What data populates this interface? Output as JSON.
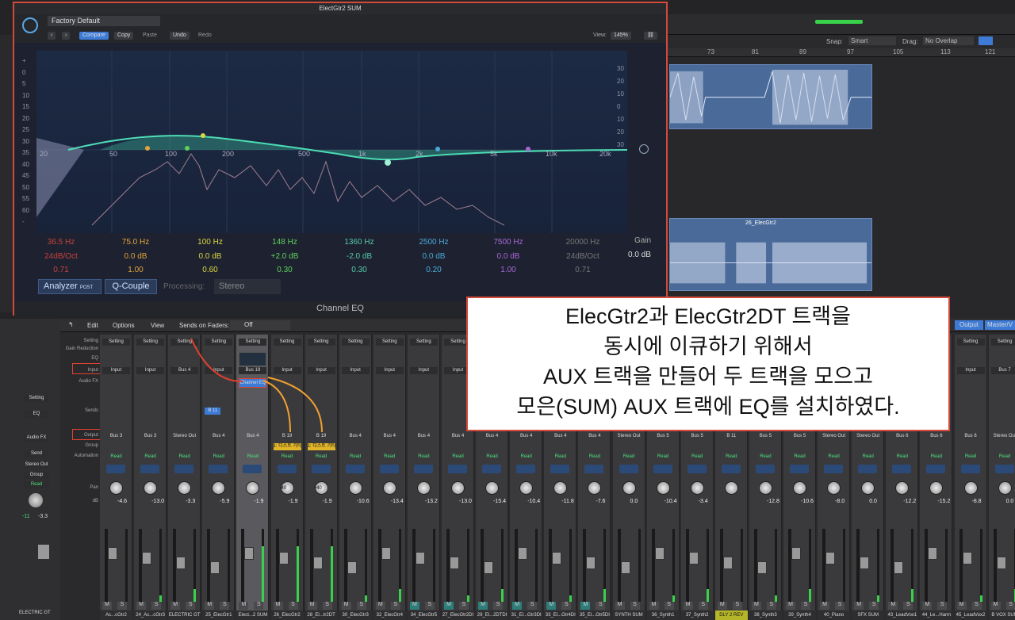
{
  "plugin": {
    "window_title": "ElectGtr2 SUM",
    "preset": "Factory Default",
    "buttons": {
      "compare": "Compare",
      "copy": "Copy",
      "paste": "Paste",
      "undo": "Undo",
      "redo": "Redo"
    },
    "view_label": "View:",
    "view_value": "145%",
    "freq_labels": [
      "20",
      "50",
      "100",
      "200",
      "500",
      "1k",
      "2k",
      "5k",
      "10k",
      "20k"
    ],
    "db_left": [
      "+",
      "0",
      "5",
      "10",
      "15",
      "20",
      "25",
      "30",
      "35",
      "40",
      "45",
      "50",
      "55",
      "60",
      "-"
    ],
    "db_right": [
      "30",
      "20",
      "10",
      "0",
      "10",
      "20",
      "30"
    ],
    "bands": [
      {
        "freq": "36.5 Hz",
        "gain": "24dB/Oct",
        "q": "0.71",
        "color": "#c8413c"
      },
      {
        "freq": "75.0 Hz",
        "gain": "0.0 dB",
        "q": "1.00",
        "color": "#e0a33a"
      },
      {
        "freq": "100 Hz",
        "gain": "0.0 dB",
        "q": "0.60",
        "color": "#d9d640"
      },
      {
        "freq": "148 Hz",
        "gain": "+2.0 dB",
        "q": "0.30",
        "color": "#5ed15a"
      },
      {
        "freq": "1360 Hz",
        "gain": "-2.0 dB",
        "q": "0.30",
        "color": "#55c9a8"
      },
      {
        "freq": "2500 Hz",
        "gain": "0.0 dB",
        "q": "0.20",
        "color": "#4aa9d8"
      },
      {
        "freq": "7500 Hz",
        "gain": "0.0 dB",
        "q": "1.00",
        "color": "#a766d6"
      },
      {
        "freq": "20000 Hz",
        "gain": "24dB/Oct",
        "q": "0.71",
        "color": "#777777"
      }
    ],
    "gain_label": "Gain",
    "gain_value": "0.0 dB",
    "analyzer": "Analyzer",
    "analyzer_post": "POST",
    "q_couple": "Q-Couple",
    "processing_label": "Processing:",
    "processing_value": "Stereo",
    "footer": "Channel EQ"
  },
  "arrange": {
    "snap_label": "Snap:",
    "snap_value": "Smart",
    "drag_label": "Drag:",
    "drag_value": "No Overlap",
    "bars": [
      "73",
      "81",
      "89",
      "97",
      "105",
      "113",
      "121"
    ],
    "region_name": "26_ElecGtr2"
  },
  "mixer": {
    "menu": {
      "edit": "Edit",
      "options": "Options",
      "view": "View",
      "sends_on_faders": "Sends on Faders:",
      "off": "Off"
    },
    "row_labels": {
      "setting": "Setting",
      "gain": "Gain Reduction",
      "eq": "EQ",
      "input": "Input",
      "audiofx": "Audio FX",
      "sends": "Sends",
      "output": "Output",
      "group": "Group",
      "automation": "Automation",
      "pan": "Pan",
      "db": "dB"
    },
    "left_strip": {
      "setting": "Setting",
      "eq": "EQ",
      "audiofx": "Audio FX",
      "send": "Send",
      "output": "Stereo Out",
      "group": "Group",
      "read": "Read",
      "db1": "-11",
      "db2": "-3.3",
      "name": "ELECTRIC GT"
    },
    "strips": [
      {
        "input": "Input",
        "output": "Bus 3",
        "db": "-4.6",
        "name": "Ac...cGtr2"
      },
      {
        "input": "Input",
        "output": "Bus 3",
        "db": "-13.0",
        "name": "24_Ac...cGtr3"
      },
      {
        "input": "Bus 4",
        "output": "Stereo Out",
        "db": "-3.3",
        "name": "ELECTRIC GT"
      },
      {
        "input": "Input",
        "output": "Bus 4",
        "db": "-5.9",
        "name": "25_ElecGtr1",
        "send": "B 11"
      },
      {
        "input": "Bus 19",
        "output": "Bus 4",
        "db": "-1.9",
        "name": "Elect...2 SUM",
        "fx": "Channel EQ"
      },
      {
        "input": "Input",
        "output": "B 19",
        "db": "-1.9",
        "name": "26_ElecGtr2",
        "pan": "-40",
        "tag": "1: 디스트 기타"
      },
      {
        "input": "Input",
        "output": "B 19",
        "db": "-1.9",
        "name": "28_El...tr2DT",
        "pan": "+40",
        "tag": "1: 디스트 기타"
      },
      {
        "input": "Input",
        "output": "Bus 4",
        "db": "-10.6",
        "name": "30_ElecGtr3"
      },
      {
        "input": "Input",
        "output": "Bus 4",
        "db": "-13.4",
        "name": "32_ElecGtr4"
      },
      {
        "input": "Input",
        "output": "Bus 4",
        "db": "-13.2",
        "name": "34_ElecGtr5"
      },
      {
        "input": "Input",
        "output": "Bus 4",
        "db": "-13.0",
        "name": "27_ElecGtr2DI"
      },
      {
        "input": "Input",
        "output": "Bus 4",
        "db": "-15.4",
        "name": "29_El...2DTDI"
      },
      {
        "input": "Input",
        "output": "Bus 4",
        "db": "-10.4",
        "name": "31_El...Gtr3DI"
      },
      {
        "input": "Input",
        "output": "Bus 4",
        "db": "-11.8",
        "name": "33_El...Gtr4DI"
      },
      {
        "input": "Input",
        "output": "Bus 4",
        "db": "-7.6",
        "name": "35_El...Gtr5DI"
      },
      {
        "input": "Input",
        "output": "Stereo Out",
        "db": "0.0",
        "name": "SYNTH SUM"
      },
      {
        "input": "Input",
        "output": "Bus 5",
        "db": "-10.4",
        "name": "36_Synth1"
      },
      {
        "input": "Input",
        "output": "Bus 5",
        "db": "-3.4",
        "name": "37_Synth2"
      },
      {
        "input": "Input",
        "output": "B 11",
        "db": "",
        "name": "DLY 2 REV"
      },
      {
        "input": "Input",
        "output": "Bus 5",
        "db": "-12.8",
        "name": "38_Synth3"
      },
      {
        "input": "Input",
        "output": "Bus 5",
        "db": "-10.6",
        "name": "39_Synth4"
      },
      {
        "input": "Input",
        "output": "Stereo Out",
        "db": "-8.0",
        "name": "40_Piano"
      },
      {
        "input": "Input",
        "output": "Stereo Out",
        "db": "0.0",
        "name": "SFX SUM"
      },
      {
        "input": "Input",
        "output": "Bus 6",
        "db": "-12.2",
        "name": "43_LeadVox1"
      },
      {
        "input": "Input",
        "output": "Bus 6",
        "db": "-15.2",
        "name": "44_Le...Harm"
      },
      {
        "input": "Input",
        "output": "Bus 6",
        "db": "-8.8",
        "name": "45_LeadVox2"
      },
      {
        "input": "Bus 7",
        "output": "Stereo Out",
        "db": "0.0",
        "name": "B VOX SUM"
      }
    ],
    "read": "Read",
    "output_menu": "Output",
    "master_menu": "Master/V"
  },
  "annotation": [
    "ElecGtr2과 ElecGtr2DT 트랙을",
    "동시에 이큐하기 위해서",
    "AUX 트랙을 만들어 두 트랙을 모으고",
    "모은(SUM) AUX 트랙에 EQ를 설치하였다."
  ]
}
